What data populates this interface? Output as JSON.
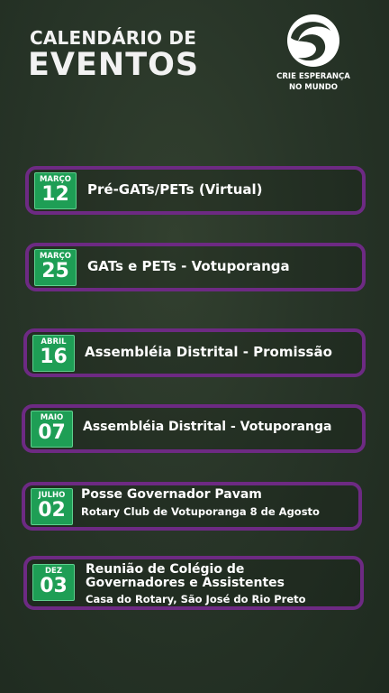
{
  "header": {
    "title_line1": "CALENDÁRIO DE",
    "title_line2": "EVENTOS"
  },
  "logo": {
    "icon": "crie-esperanca-icon",
    "text_line1": "CRIE ESPERANÇA",
    "text_line2": "NO MUNDO"
  },
  "events": [
    {
      "month": "MARÇO",
      "day": "12",
      "title": "Pré-GATs/PETs (Virtual)",
      "subtitle": ""
    },
    {
      "month": "MARÇO",
      "day": "25",
      "title": "GATs e PETs - Votuporanga",
      "subtitle": ""
    },
    {
      "month": "ABRIL",
      "day": "16",
      "title": "Assembléia Distrital - Promissão",
      "subtitle": ""
    },
    {
      "month": "MAIO",
      "day": "07",
      "title": "Assembléia Distrital - Votuporanga",
      "subtitle": ""
    },
    {
      "month": "JULHO",
      "day": "02",
      "title": "Posse Governador Pavam",
      "subtitle": "Rotary Club de Votuporanga 8 de Agosto"
    },
    {
      "month": "DEZ",
      "day": "03",
      "title": "Reunião de Colégio de Governadores e Assistentes",
      "subtitle": "Casa do Rotary, São José do Rio Preto"
    }
  ],
  "colors": {
    "background": "#283528",
    "border": "#6d2a83",
    "badge": "#1e9e55"
  }
}
